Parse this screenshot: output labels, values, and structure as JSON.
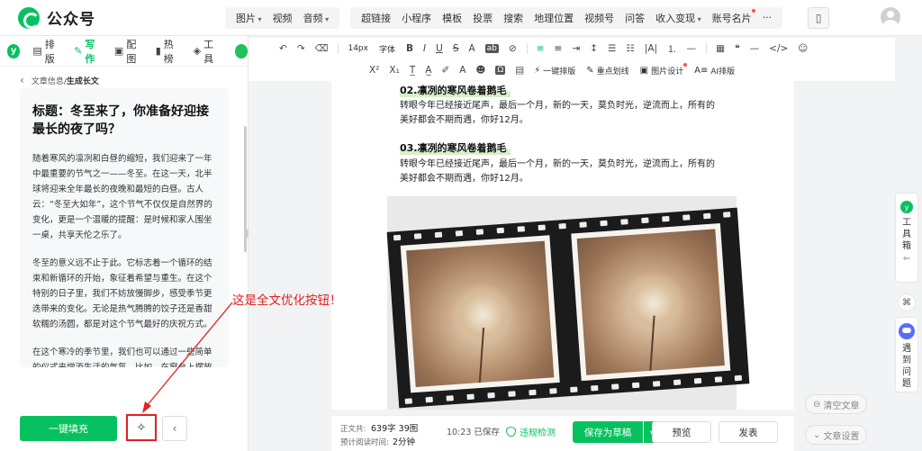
{
  "header": {
    "brand": "公众号",
    "menu_groups": [
      [
        "图片",
        "视频",
        "音频"
      ],
      [
        "超链接",
        "小程序",
        "模板",
        "投票",
        "搜索",
        "地理位置",
        "视频号",
        "问答",
        "收入变现",
        "账号名片",
        "···"
      ]
    ]
  },
  "toolbar1": {
    "font_size": "14px",
    "font_family": "字体",
    "bold": "B",
    "italic": "I",
    "underline": "U",
    "strike": "S",
    "font_color": "A",
    "bg_color": "ab"
  },
  "toolbar2": {
    "superscript": "X²",
    "subscript": "X₁",
    "one_click_layout": "一键排版",
    "highlight": "重点划线",
    "image_design": "图片设计",
    "ai_layout": "AI排版"
  },
  "left_panel": {
    "tabs": [
      "排版",
      "写作",
      "配图",
      "热榜",
      "工具"
    ],
    "breadcrumb_parent": "文章信息/",
    "breadcrumb_current": "生成长文",
    "article": {
      "title": "标题：冬至来了，你准备好迎接最长的夜了吗？",
      "paragraphs": [
        "随着寒风的凛冽和白昼的缩短，我们迎来了一年中最重要的节气之一——冬至。在这一天，北半球将迎来全年最长的夜晚和最短的白昼。古人云：“冬至大如年”，这个节气不仅仅是自然界的变化，更是一个温暖的提醒：是时候和家人围坐一桌，共享天伦之乐了。",
        "冬至的意义远不止于此。它标志着一个循环的结束和新循环的开始，象征着希望与重生。在这个特别的日子里，我们不妨放慢脚步，感受季节更迭带来的变化。无论是热气腾腾的饺子还是香甜软糯的汤圆，都是对这个节气最好的庆祝方式。",
        "在这个寒冷的季节里，我们也可以通过一些简单的仪式来增添生活的气氛。比如，在窗台上摆放"
      ]
    },
    "fill_button": "一键填充"
  },
  "editor": {
    "sections": [
      {
        "heading": "02.凛冽的寒风卷着鹅毛",
        "text": "转眼今年已经接近尾声，最后一个月，新的一天，莫负时光，逆流而上，所有的美好都会不期而遇，你好12月。"
      },
      {
        "heading": "03.凛冽的寒风卷着鹅毛",
        "text": "转眼今年已经接近尾声，最后一个月，新的一天，莫负时光，逆流而上，所有的美好都会不期而遇，你好12月。"
      }
    ]
  },
  "status": {
    "word_label": "正文共:",
    "word_value": "639字 39图",
    "read_label": "预计阅读时间:",
    "read_value": "2分钟",
    "save_time": "10:23  已保存",
    "violation": "违规检测",
    "save_draft": "保存为草稿",
    "preview": "预览",
    "publish": "发表"
  },
  "right_side": {
    "toolbox": "工具箱",
    "question": "遇到问题",
    "clear": "清空文章",
    "settings": "文章设置"
  },
  "annotation": "这是全文优化按钮！",
  "colors": {
    "brand_green": "#07c160",
    "annotation_red": "#e02020"
  }
}
